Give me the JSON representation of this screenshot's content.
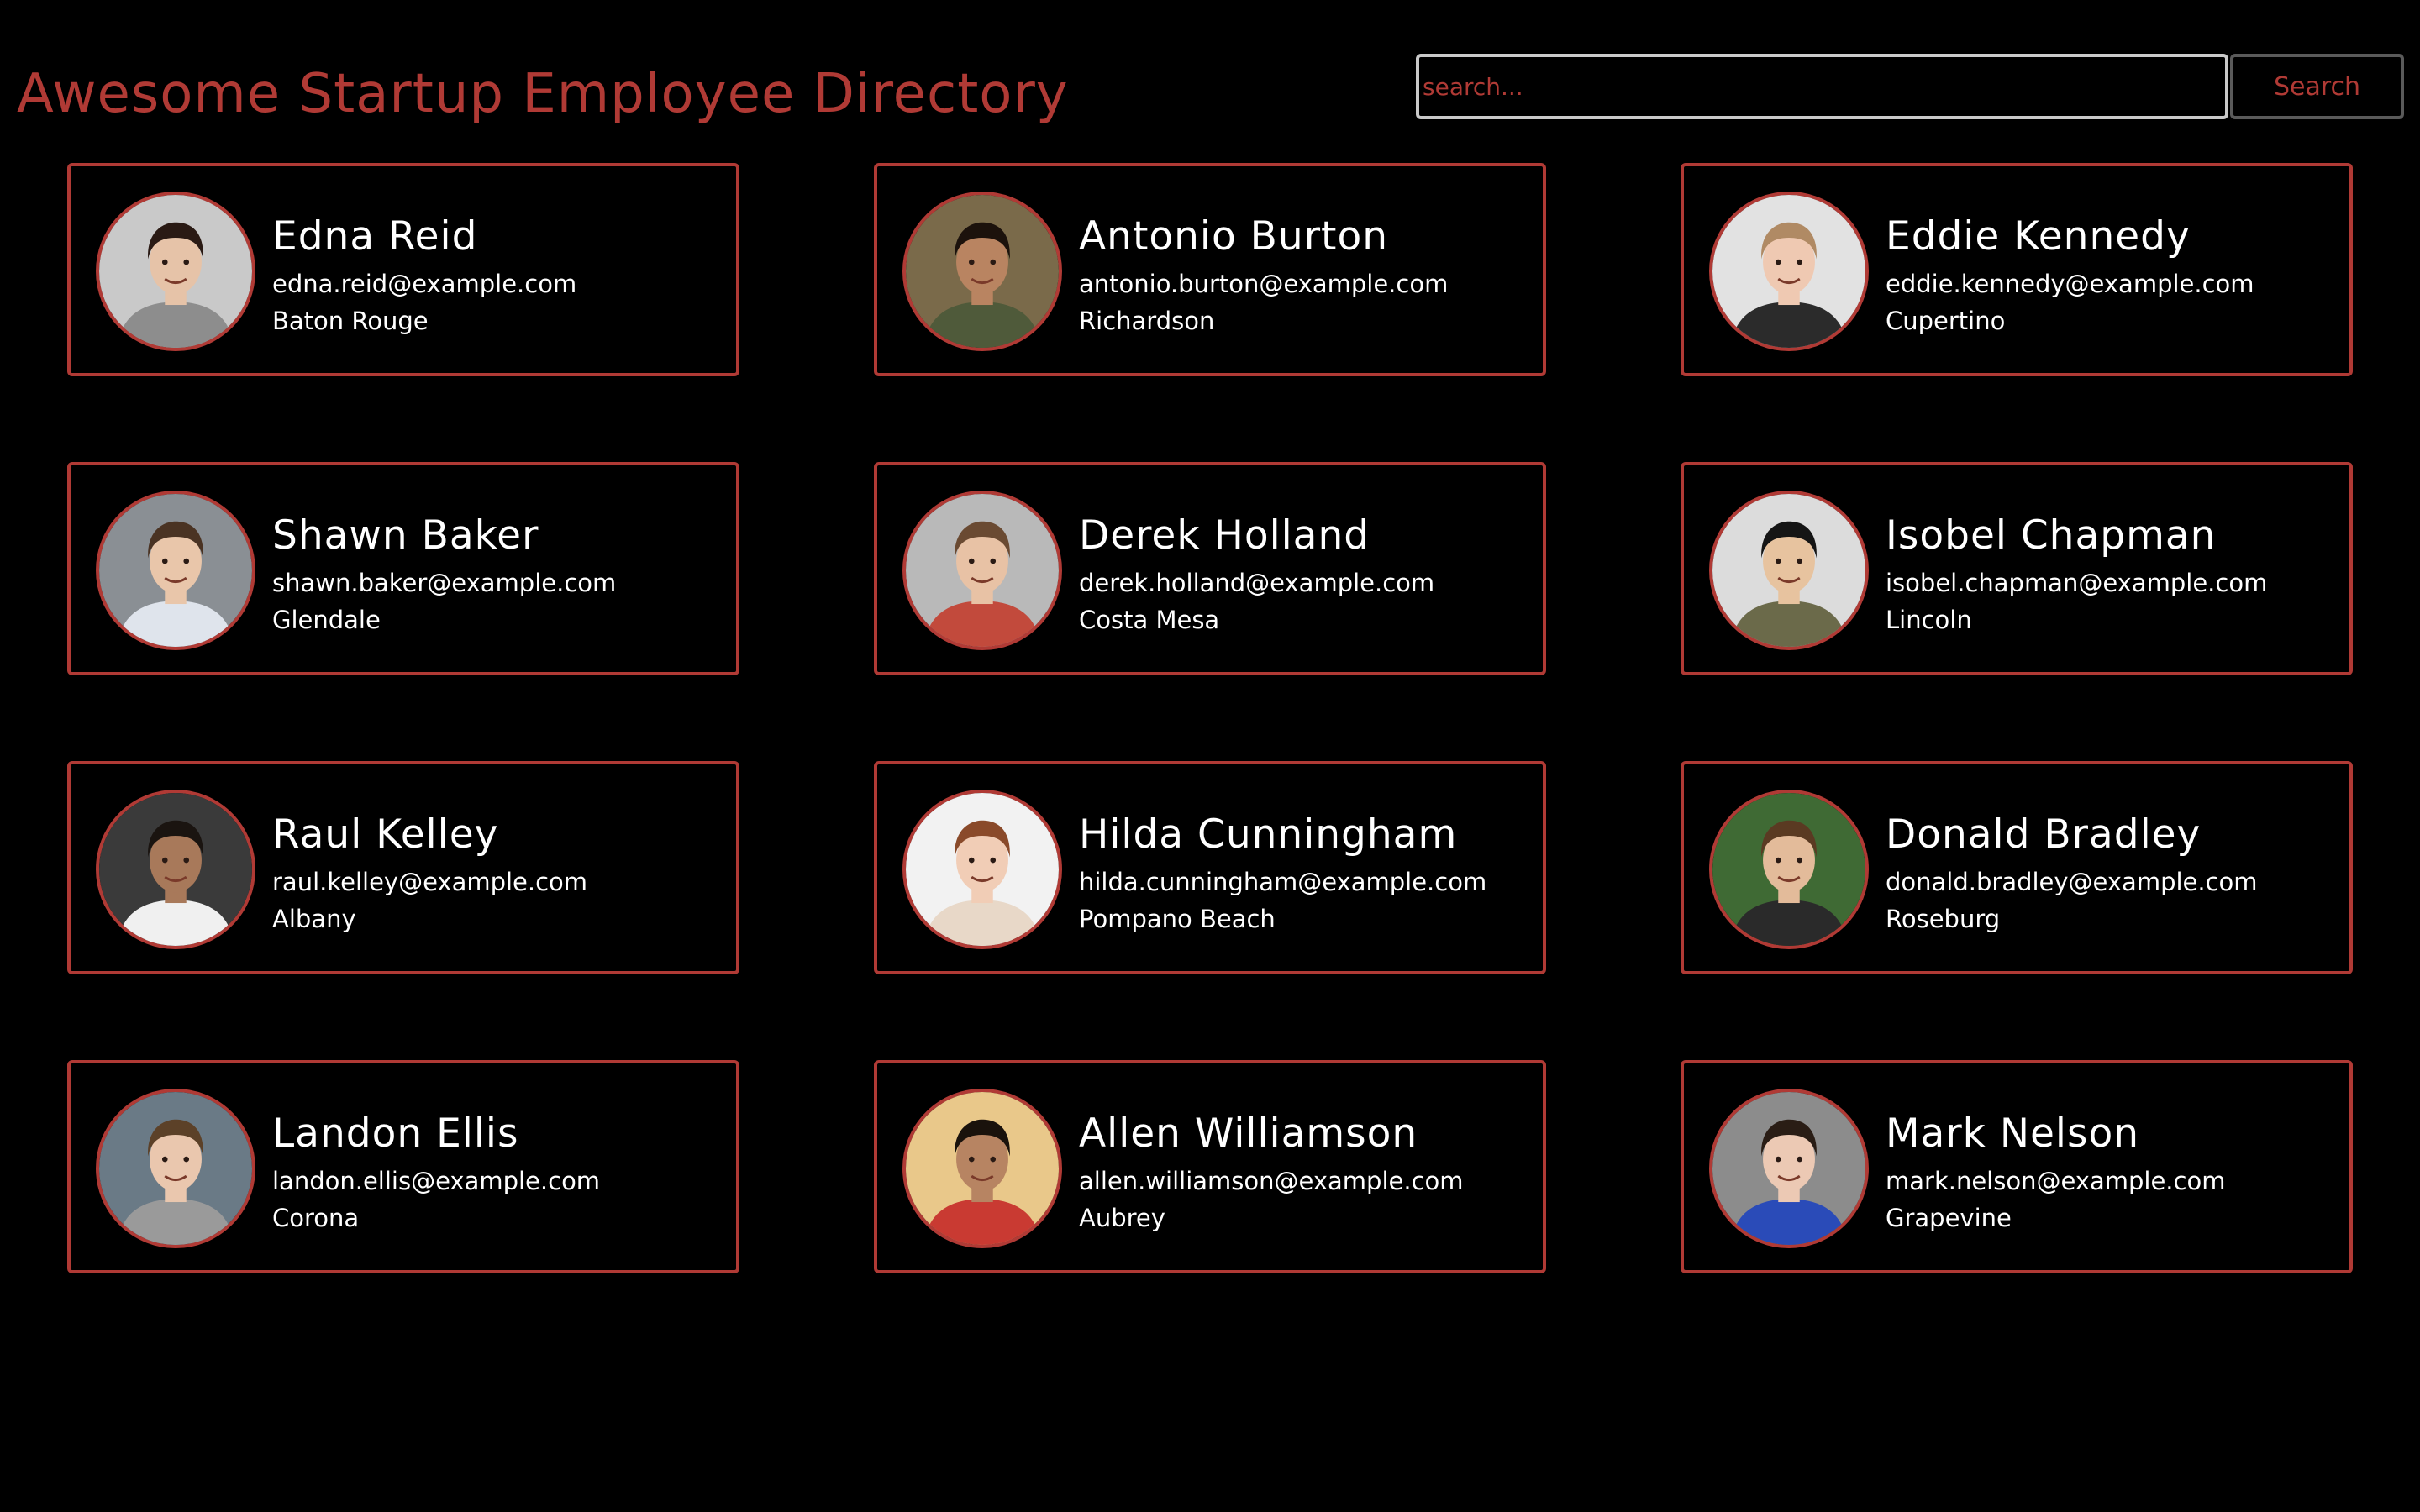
{
  "app": {
    "title": "Awesome Startup Employee Directory"
  },
  "search": {
    "placeholder": "search...",
    "value": "",
    "button_label": "Search"
  },
  "theme": {
    "accent": "#b03a35",
    "background": "#000000",
    "text": "#ffffff",
    "input_border": "#c9c9c9"
  },
  "employees": [
    {
      "name": "Edna Reid",
      "email": "edna.reid@example.com",
      "city": "Baton Rouge",
      "photo": "woman-surprised-hand-on-mouth"
    },
    {
      "name": "Antonio Burton",
      "email": "antonio.burton@example.com",
      "city": "Richardson",
      "photo": "man-smiling-dark-hair"
    },
    {
      "name": "Eddie Kennedy",
      "email": "eddie.kennedy@example.com",
      "city": "Cupertino",
      "photo": "man-smiling-short-hair"
    },
    {
      "name": "Shawn Baker",
      "email": "shawn.baker@example.com",
      "city": "Glendale",
      "photo": "man-white-shirt"
    },
    {
      "name": "Derek Holland",
      "email": "derek.holland@example.com",
      "city": "Costa Mesa",
      "photo": "man-glasses-red-shirt"
    },
    {
      "name": "Isobel Chapman",
      "email": "isobel.chapman@example.com",
      "city": "Lincoln",
      "photo": "woman-smiling-dark-hair"
    },
    {
      "name": "Raul Kelley",
      "email": "raul.kelley@example.com",
      "city": "Albany",
      "photo": "man-headset-white-shirt"
    },
    {
      "name": "Hilda Cunningham",
      "email": "hilda.cunningham@example.com",
      "city": "Pompano Beach",
      "photo": "woman-bangs-auburn-hair"
    },
    {
      "name": "Donald Bradley",
      "email": "donald.bradley@example.com",
      "city": "Roseburg",
      "photo": "man-suit-beard"
    },
    {
      "name": "Landon Ellis",
      "email": "landon.ellis@example.com",
      "city": "Corona",
      "photo": "young-man-outdoors"
    },
    {
      "name": "Allen Williamson",
      "email": "allen.williamson@example.com",
      "city": "Aubrey",
      "photo": "man-red-shirt-curly-hair"
    },
    {
      "name": "Mark Nelson",
      "email": "mark.nelson@example.com",
      "city": "Grapevine",
      "photo": "young-man-blue-shirt"
    }
  ]
}
